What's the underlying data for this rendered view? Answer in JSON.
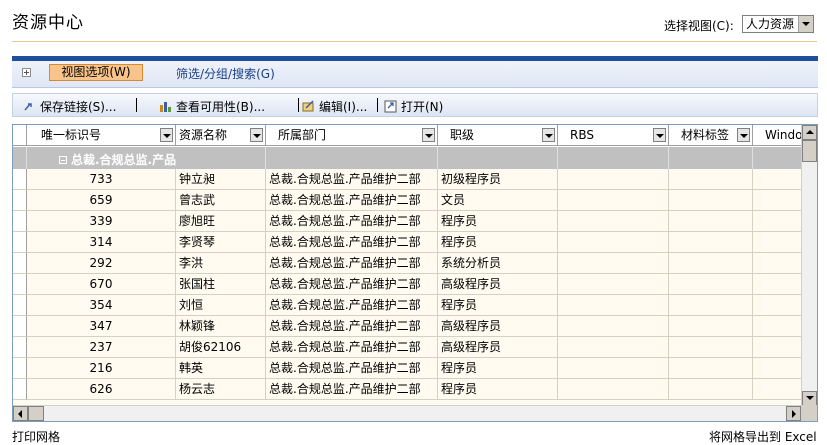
{
  "header": {
    "title": "资源中心",
    "view_label": "选择视图(C):",
    "view_value": "人力资源"
  },
  "options": {
    "view_options": "视图选项(W)",
    "filter": "筛选/分组/搜索(G)"
  },
  "toolbar": {
    "save_link": "保存链接(S)...",
    "check_availability": "查看可用性(B)...",
    "edit": "编辑(I)...",
    "open": "打开(N)"
  },
  "grid": {
    "columns": [
      "唯一标识号",
      "资源名称",
      "所属部门",
      "职级",
      "RBS",
      "材料标签",
      "Windo"
    ],
    "group_label": "总裁.合规总监.产品",
    "rows": [
      {
        "id": "733",
        "name": "钟立昶",
        "dept": "总裁.合规总监.产品维护二部",
        "level": "初级程序员"
      },
      {
        "id": "659",
        "name": "曾志武",
        "dept": "总裁.合规总监.产品维护二部",
        "level": "文员"
      },
      {
        "id": "339",
        "name": "廖旭旺",
        "dept": "总裁.合规总监.产品维护二部",
        "level": "程序员"
      },
      {
        "id": "314",
        "name": "李贤琴",
        "dept": "总裁.合规总监.产品维护二部",
        "level": "程序员"
      },
      {
        "id": "292",
        "name": "李洪",
        "dept": "总裁.合规总监.产品维护二部",
        "level": "系统分析员"
      },
      {
        "id": "670",
        "name": "张国柱",
        "dept": "总裁.合规总监.产品维护二部",
        "level": "高级程序员"
      },
      {
        "id": "354",
        "name": "刘恒",
        "dept": "总裁.合规总监.产品维护二部",
        "level": "程序员"
      },
      {
        "id": "347",
        "name": "林颖锋",
        "dept": "总裁.合规总监.产品维护二部",
        "level": "高级程序员"
      },
      {
        "id": "237",
        "name": "胡俊62106",
        "dept": "总裁.合规总监.产品维护二部",
        "level": "高级程序员"
      },
      {
        "id": "216",
        "name": "韩英",
        "dept": "总裁.合规总监.产品维护二部",
        "level": "程序员"
      },
      {
        "id": "626",
        "name": "杨云志",
        "dept": "总裁.合规总监.产品维护二部",
        "level": "程序员"
      }
    ]
  },
  "footer": {
    "print": "打印网格",
    "export": "将网格导出到 Excel"
  },
  "colors": {
    "accent_blue": "#1e4f9c",
    "tab_orange": "#f9c48a",
    "group_gray": "#c0c0c0",
    "row_cream": "#fffbf0"
  }
}
